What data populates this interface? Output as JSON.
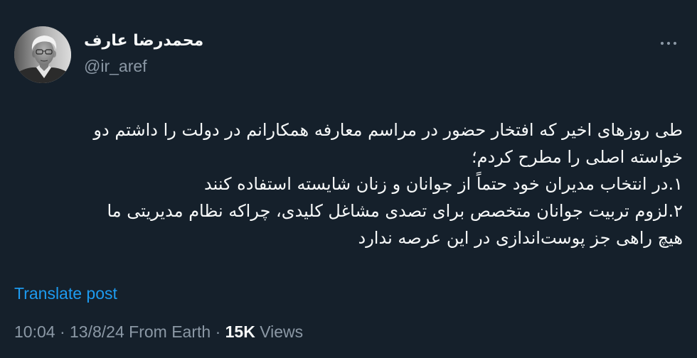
{
  "colors": {
    "background": "#15202b",
    "text_primary": "#f7f9f9",
    "text_secondary": "#8b98a5",
    "link": "#1d9bf0"
  },
  "icons": {
    "more": "more-horizontal-icon"
  },
  "author": {
    "display_name": "محمدرضا عارف",
    "handle": "@ir_aref"
  },
  "tweet": {
    "lines": [
      "طی روزهای اخیر که افتخار حضور در مراسم معارفه همکارانم در دولت را داشتم دو",
      "خواسته اصلی را مطرح کردم؛",
      "۱.در انتخاب مدیران خود حتماً از جوانان و زنان شایسته استفاده کنند",
      "۲.لزوم تربیت جوانان متخصص برای تصدی مشاغل کلیدی، چراکه نظام مدیریتی ما",
      "هیچ راهی جز پوست‌اندازی در این عرصه ندارد"
    ]
  },
  "translate_label": "Translate post",
  "meta": {
    "time": "10:04",
    "separator": "·",
    "date": "13/8/24",
    "source": "From Earth",
    "views_count": "15K",
    "views_label": "Views"
  }
}
